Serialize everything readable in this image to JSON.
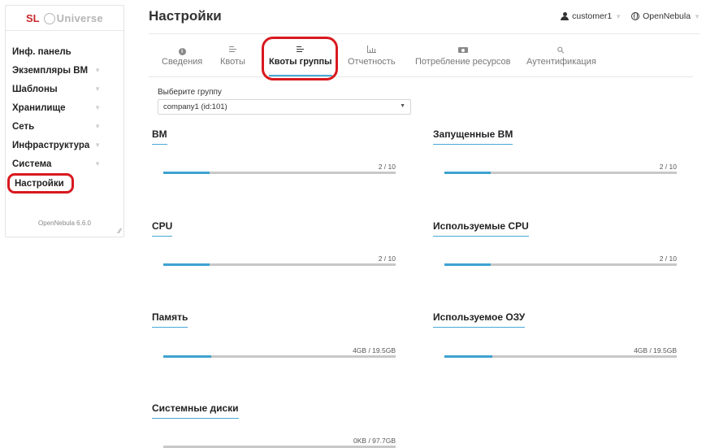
{
  "brand": {
    "prefix": "SL",
    "name": "Universe"
  },
  "sidebar": {
    "items": [
      {
        "label": "Инф. панель",
        "chevron": false
      },
      {
        "label": "Экземпляры ВМ",
        "chevron": true
      },
      {
        "label": "Шаблоны",
        "chevron": true
      },
      {
        "label": "Хранилище",
        "chevron": true
      },
      {
        "label": "Сеть",
        "chevron": true
      },
      {
        "label": "Инфраструктура",
        "chevron": true
      },
      {
        "label": "Система",
        "chevron": true
      },
      {
        "label": "Настройки",
        "chevron": false,
        "active": true
      }
    ],
    "version": "OpenNebula 6.6.0"
  },
  "header": {
    "title": "Настройки",
    "user": "customer1",
    "zone": "OpenNebula"
  },
  "tabs": [
    {
      "label": "Сведения",
      "icon": "info-icon"
    },
    {
      "label": "Квоты",
      "icon": "bars-icon"
    },
    {
      "label": "Квоты группы",
      "icon": "bars-icon",
      "active": true
    },
    {
      "label": "Отчетность",
      "icon": "chart-icon"
    },
    {
      "label": "Потребление ресурсов",
      "icon": "money-icon"
    },
    {
      "label": "Аутентификация",
      "icon": "key-icon"
    }
  ],
  "group_select": {
    "label": "Выберите группу",
    "value": "company1 (id:101)"
  },
  "quotas": [
    {
      "id": "vm",
      "title": "ВМ",
      "value": "2 / 10",
      "fraction": 0.2
    },
    {
      "id": "running-vm",
      "title": "Запущенные ВМ",
      "value": "2 / 10",
      "fraction": 0.2
    },
    {
      "id": "cpu",
      "title": "CPU",
      "value": "2 / 10",
      "fraction": 0.2
    },
    {
      "id": "used-cpu",
      "title": "Используемые CPU",
      "value": "2 / 10",
      "fraction": 0.2
    },
    {
      "id": "memory",
      "title": "Память",
      "value": "4GB / 19.5GB",
      "fraction": 0.205
    },
    {
      "id": "used-ram",
      "title": "Используемое ОЗУ",
      "value": "4GB / 19.5GB",
      "fraction": 0.205
    },
    {
      "id": "system-disks",
      "title": "Системные диски",
      "value": "0KB / 97.7GB",
      "fraction": 0
    }
  ],
  "colors": {
    "accent": "#3ea2d2",
    "highlight": "#d8191f",
    "brand": "#c8282e"
  }
}
